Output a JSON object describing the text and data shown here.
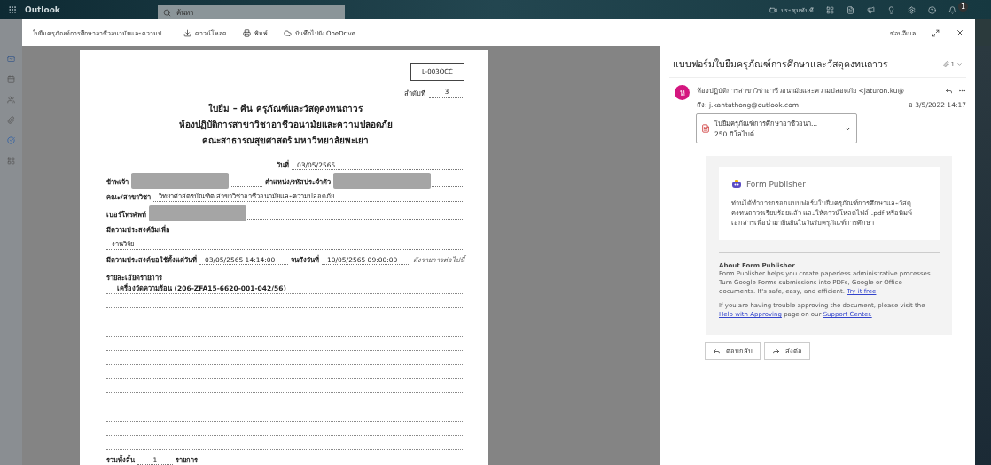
{
  "app_bar": {
    "app_name": "Outlook",
    "search": {
      "placeholder": "ค้นหา"
    },
    "meet_now": "ประชุมทันที",
    "notification_count": "1"
  },
  "viewer_toolbar": {
    "file_name": "ใบยืมครุภัณฑ์การศึกษาอาชีวอนามัยและความป...",
    "actions": [
      {
        "kind": "download",
        "label": "ดาวน์โหลด"
      },
      {
        "kind": "print",
        "label": "พิมพ์"
      },
      {
        "kind": "cloud",
        "label": "บันทึกไปยัง OneDrive"
      }
    ],
    "hide_email": "ซ่อนอีเมล"
  },
  "document": {
    "code": "L-003OCC",
    "number_label": "ลำดับที่",
    "number": "3",
    "title_lines": [
      "ใบยืม – คืน ครุภัณฑ์และวัสดุคงทนถาวร",
      "ห้องปฏิบัติการสาขาวิชาอาชีวอนามัยและความปลอดภัย",
      "คณะสาธารณสุขศาสตร์ มหาวิทยาลัยพะเยา"
    ],
    "rows": [
      {
        "cells": [
          {
            "kind": "gap"
          },
          {
            "kind": "label",
            "text": "วันที่"
          },
          {
            "kind": "value",
            "text": "03/05/2565"
          }
        ]
      },
      {
        "cells": [
          {
            "kind": "label",
            "text": "ข้าพเจ้า"
          },
          {
            "kind": "redacted"
          },
          {
            "kind": "label",
            "text": "ตำแหน่ง/รหัสประจำตัว"
          },
          {
            "kind": "redacted"
          }
        ]
      },
      {
        "cells": [
          {
            "kind": "label",
            "text": "คณะ/สาขาวิชา"
          },
          {
            "kind": "value",
            "text": "วิทยาศาสตรบัณฑิต สาขาวิชาอาชีวอนามัยและความปลอดภัย"
          }
        ]
      },
      {
        "cells": [
          {
            "kind": "label",
            "text": "เบอร์โทรศัพท์"
          },
          {
            "kind": "redacted"
          }
        ]
      },
      {
        "cells": [
          {
            "kind": "label",
            "text": "มีความประสงค์ยืมเพื่อ"
          }
        ]
      },
      {
        "cells": [
          {
            "kind": "value",
            "text": "งานวิจัย"
          }
        ]
      },
      {
        "cells": [
          {
            "kind": "label",
            "text": "มีความประสงค์ขอใช้ตั้งแต่วันที่"
          },
          {
            "kind": "value",
            "text": "03/05/2565 14:14:00"
          },
          {
            "kind": "label",
            "text": "จนถึงวันที่"
          },
          {
            "kind": "value",
            "text": "10/05/2565 09:00:00"
          },
          {
            "kind": "note",
            "text": "ดังรายการต่อไปนี้"
          }
        ]
      }
    ],
    "items_heading": "รายละเอียดรายการ",
    "items": [
      "เครื่องวัดความร้อน (206-ZFA15-6620-001-042/56)"
    ],
    "total_label": "รวมทั้งสิ้น",
    "total": "1",
    "total_unit": "รายการ"
  },
  "email": {
    "subject": "แบบฟอร์มใบยืมครุภัณฑ์การศึกษาและวัสดุคงทนถาวร",
    "attachment_count": "1",
    "avatar": "ห",
    "sender": "ห้องปฏิบัติการสาขาวิชาอาชีวอนามัยและความปลอดภัย <jaturon.ku@",
    "to": "ถึง: j.kantathong@outlook.com",
    "date": "อ 3/5/2022 14:17",
    "attachment": {
      "name": "ใบยืมครุภัณฑ์การศึกษาอาชีวอนา...",
      "size": "250 กิโลไบต์"
    },
    "card": {
      "brand": "Form Publisher",
      "message": "ท่านได้ทำการกรอกแบบฟอร์มใบยืมครุภัณฑ์การศึกษาและวัสดุคงทนถาวรเรียบร้อยแล้ว และให้ดาวน์โหลดไฟล์ .pdf หรือพิมพ์เอกสารเพื่อนำมายืนยันในวันรับครุภัณฑ์การศึกษา"
    },
    "about": {
      "heading": "About Form Publisher",
      "paragraphs": [
        [
          {
            "kind": "text",
            "text": "Form Publisher helps you create paperless administrative processes. Turn Google Forms submissions into PDFs, Google or Office documents. It's safe, easy, and efficient. "
          },
          {
            "kind": "link",
            "text": "Try it free"
          }
        ],
        [
          {
            "kind": "text",
            "text": "If you are having trouble approving the document, please visit the "
          },
          {
            "kind": "link",
            "text": "Help with Approving"
          },
          {
            "kind": "text",
            "text": " page on our "
          },
          {
            "kind": "link",
            "text": "Support Center."
          }
        ]
      ]
    },
    "actions": [
      {
        "kind": "reply",
        "label": "ตอบกลับ"
      },
      {
        "kind": "forward",
        "label": "ส่งต่อ"
      }
    ]
  }
}
